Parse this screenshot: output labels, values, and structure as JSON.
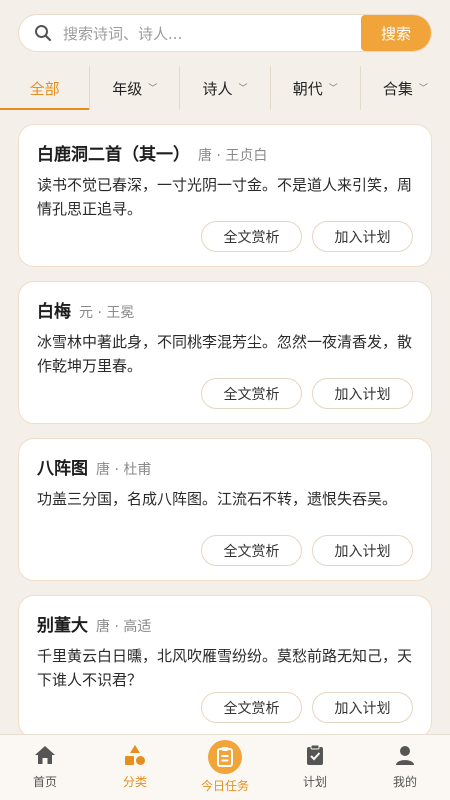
{
  "search": {
    "placeholder": "搜索诗词、诗人...",
    "button_label": "搜索"
  },
  "filters": [
    {
      "label": "全部",
      "active": true
    },
    {
      "label": "年级"
    },
    {
      "label": "诗人"
    },
    {
      "label": "朝代"
    },
    {
      "label": "合集"
    }
  ],
  "poems": [
    {
      "title": "白鹿洞二首（其一）",
      "author": "唐 · 王贞白",
      "text": "读书不觉已春深，一寸光阴一寸金。不是道人来引笑，周情孔思正追寻。",
      "analysis_label": "全文赏析",
      "plan_label": "加入计划"
    },
    {
      "title": "白梅",
      "author": "元 · 王冕",
      "text": "冰雪林中著此身，不同桃李混芳尘。忽然一夜清香发，散作乾坤万里春。",
      "analysis_label": "全文赏析",
      "plan_label": "加入计划"
    },
    {
      "title": "八阵图",
      "author": "唐 · 杜甫",
      "text": "功盖三分国，名成八阵图。江流石不转，遗恨失吞吴。",
      "analysis_label": "全文赏析",
      "plan_label": "加入计划"
    },
    {
      "title": "别董大",
      "author": "唐 · 高适",
      "text": "千里黄云白日曛，北风吹雁雪纷纷。莫愁前路无知己，天下谁人不识君？",
      "analysis_label": "全文赏析",
      "plan_label": "加入计划"
    }
  ],
  "nav": [
    {
      "label": "首页",
      "icon": "home-icon"
    },
    {
      "label": "分类",
      "icon": "category-icon",
      "active": true
    },
    {
      "label": "今日任务",
      "icon": "today-task-icon"
    },
    {
      "label": "计划",
      "icon": "plan-icon"
    },
    {
      "label": "我的",
      "icon": "profile-icon"
    }
  ],
  "colors": {
    "accent": "#f0a43a",
    "accent_text": "#e58f1f",
    "background": "#f4efe9"
  }
}
